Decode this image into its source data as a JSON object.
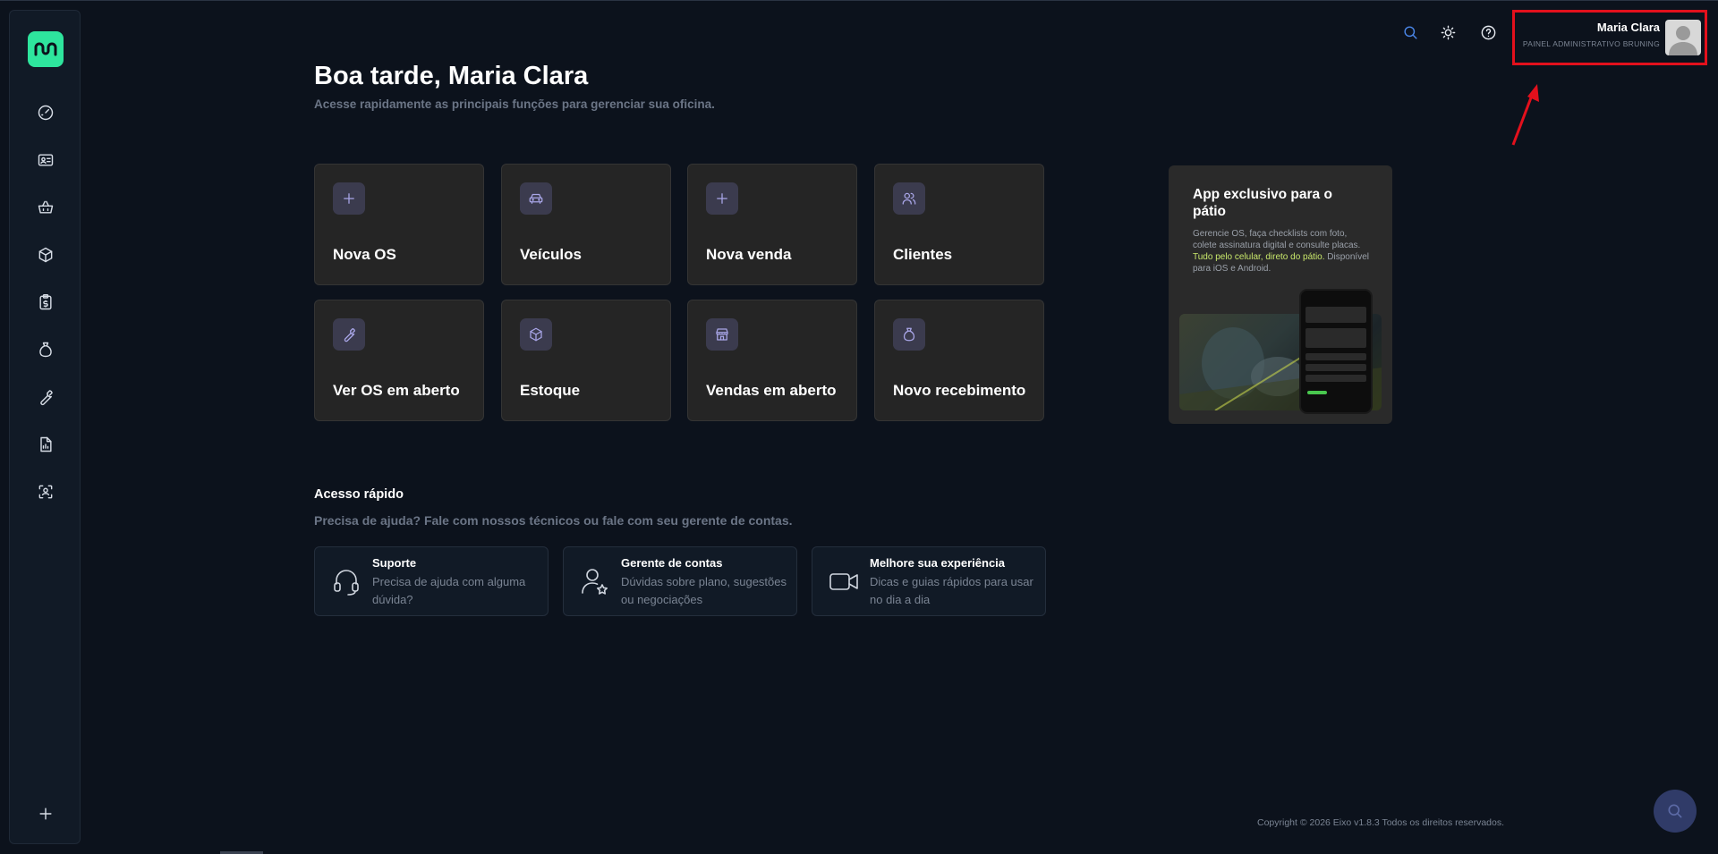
{
  "header": {
    "user_name": "Maria Clara",
    "user_role": "PAINEL ADMINISTRATIVO BRUNING",
    "icons": [
      "search-icon",
      "sun-icon",
      "help-icon"
    ]
  },
  "sidebar": {
    "items": [
      {
        "icon": "dashboard-icon"
      },
      {
        "icon": "id-card-icon"
      },
      {
        "icon": "basket-icon"
      },
      {
        "icon": "box-icon"
      },
      {
        "icon": "clipboard-dollar-icon"
      },
      {
        "icon": "money-bag-icon"
      },
      {
        "icon": "wrench-icon"
      },
      {
        "icon": "report-icon"
      },
      {
        "icon": "scan-user-icon"
      }
    ],
    "add_icon": "plus-icon"
  },
  "greeting": {
    "title": "Boa tarde, Maria Clara",
    "subtitle": "Acesse rapidamente as principais funções para gerenciar sua oficina."
  },
  "cards": [
    {
      "label": "Nova OS",
      "icon": "plus-icon"
    },
    {
      "label": "Veículos",
      "icon": "car-icon"
    },
    {
      "label": "Nova venda",
      "icon": "plus-icon"
    },
    {
      "label": "Clientes",
      "icon": "users-icon"
    },
    {
      "label": "Ver OS em aberto",
      "icon": "wrench-icon"
    },
    {
      "label": "Estoque",
      "icon": "box-icon"
    },
    {
      "label": "Vendas em aberto",
      "icon": "store-icon"
    },
    {
      "label": "Novo recebimento",
      "icon": "money-bag-icon"
    }
  ],
  "promo": {
    "title": "App exclusivo para o pátio",
    "text_1": "Gerencie OS, faça checklists com foto, colete assinatura digital e consulte placas. ",
    "text_highlight": "Tudo pelo celular, direto do pátio.",
    "text_2": " Disponível para iOS e Android."
  },
  "quick_access": {
    "title": "Acesso rápido",
    "subtitle": "Precisa de ajuda? Fale com nossos técnicos ou fale com seu gerente de contas.",
    "items": [
      {
        "title": "Suporte",
        "desc": "Precisa de ajuda com alguma dúvida?",
        "icon": "headset-icon"
      },
      {
        "title": "Gerente de contas",
        "desc": "Dúvidas sobre plano, sugestões ou negociações",
        "icon": "user-star-icon"
      },
      {
        "title": "Melhore sua experiência",
        "desc": "Dicas e guias rápidos para usar no dia a dia",
        "icon": "video-icon"
      }
    ]
  },
  "footer": {
    "text": "Copyright © 2026 Eixo v1.8.3 Todos os direitos reservados."
  },
  "colors": {
    "background": "#0c121c",
    "accent": "#2ee59d",
    "card": "#252525",
    "icon_tile": "#3b3b4e",
    "highlight": "#e3101c"
  }
}
